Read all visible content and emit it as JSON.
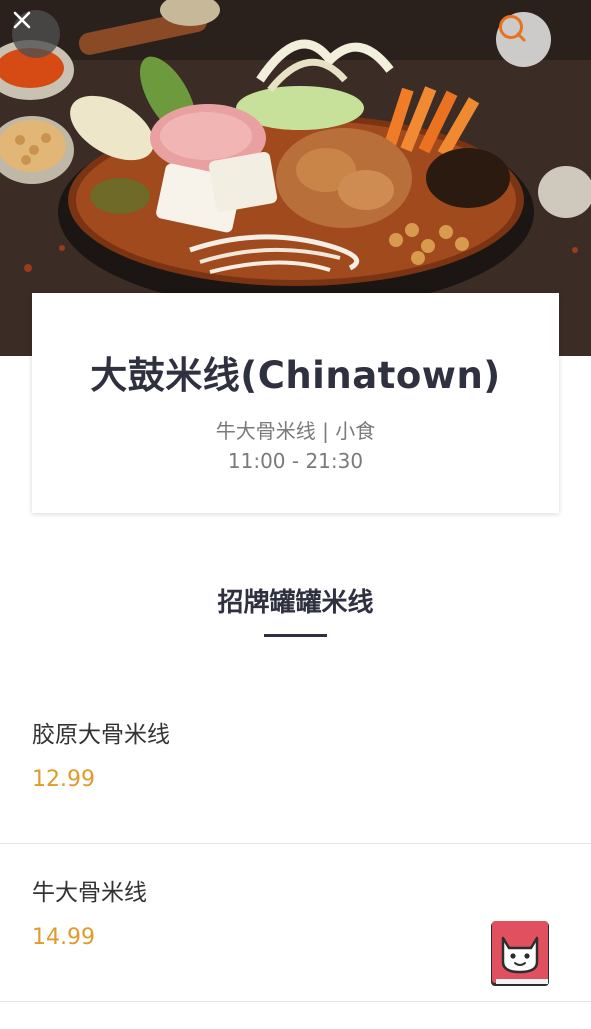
{
  "header": {
    "close_icon": "close-icon",
    "search_icon": "search-icon"
  },
  "restaurant": {
    "name": "大鼓米线(Chinatown)",
    "categories": "牛大骨米线 | 小食",
    "hours": "11:00 - 21:30"
  },
  "section": {
    "title": "招牌罐罐米线"
  },
  "menu": {
    "items": [
      {
        "name": "胶原大骨米线",
        "price": "12.99"
      },
      {
        "name": "牛大骨米线",
        "price": "14.99"
      }
    ]
  },
  "floating_badge": {
    "icon": "cat-face-icon"
  },
  "colors": {
    "price": "#e19a2b",
    "title_text": "#2f3140",
    "badge": "#e0505e"
  }
}
